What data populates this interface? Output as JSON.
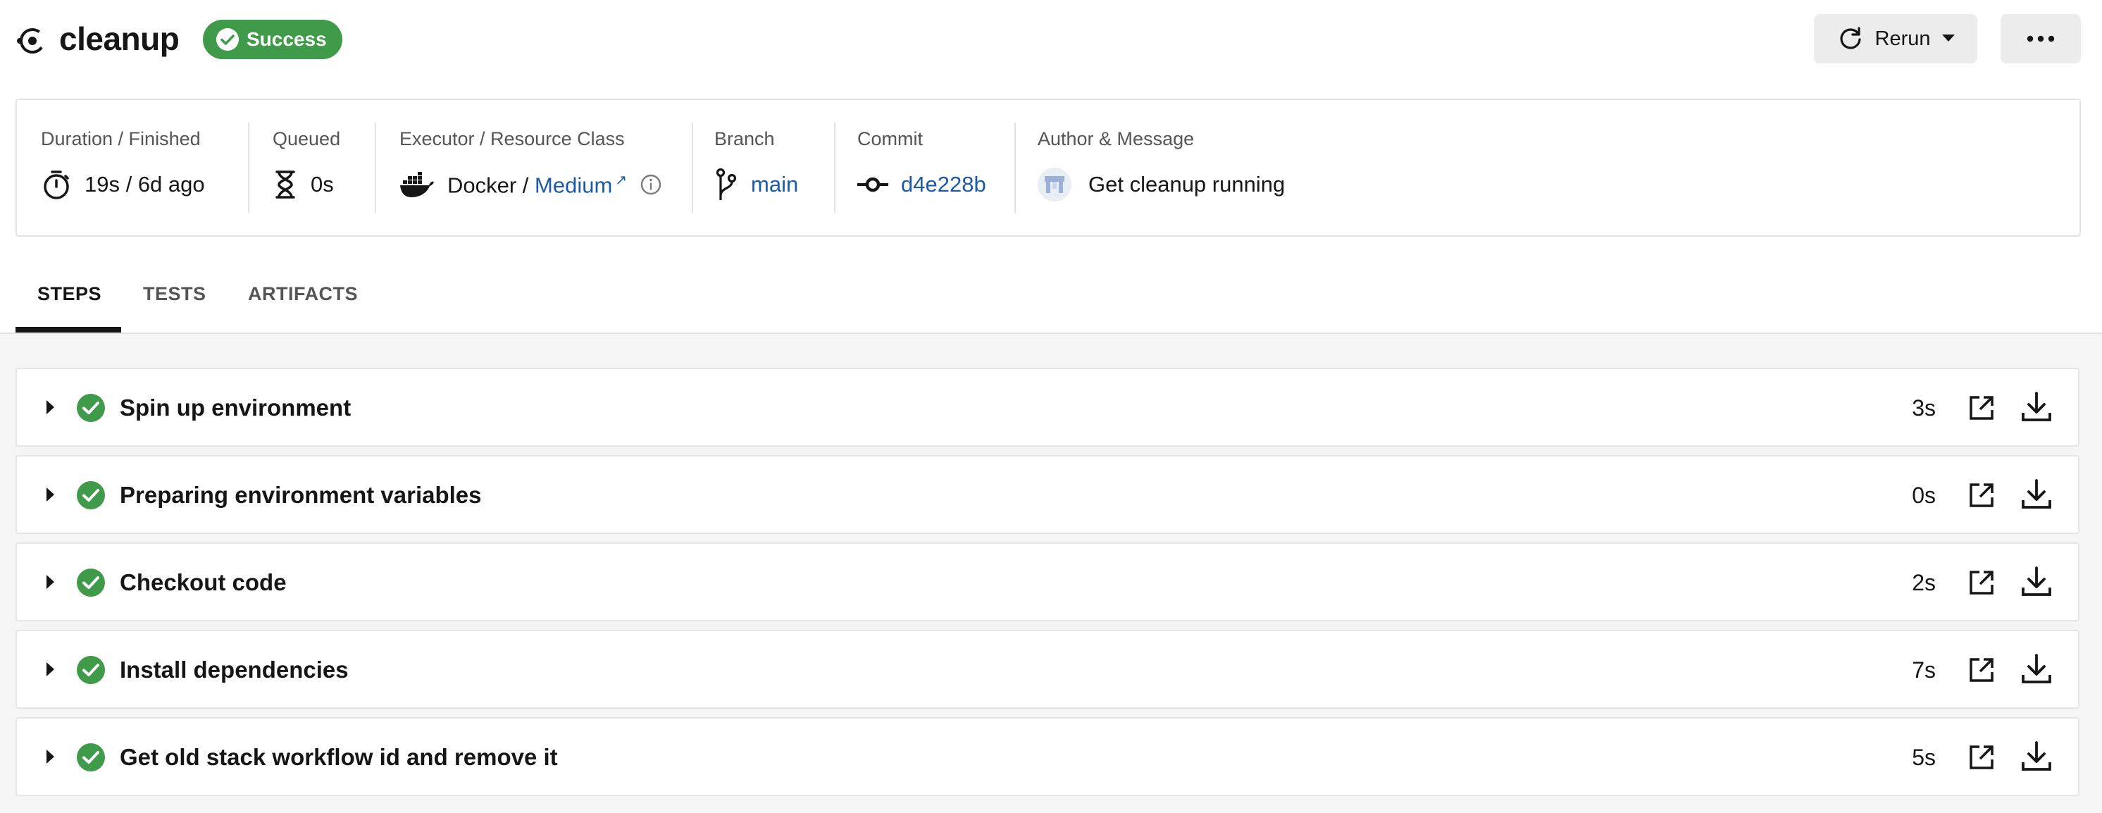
{
  "job": {
    "title": "cleanup",
    "status": "Success",
    "status_color": "#3f9b49"
  },
  "actions": {
    "rerun_label": "Rerun"
  },
  "info": {
    "duration": {
      "label": "Duration / Finished",
      "value": "19s / 6d ago",
      "icon": "stopwatch-icon"
    },
    "queued": {
      "label": "Queued",
      "value": "0s",
      "icon": "hourglass-icon"
    },
    "executor": {
      "label": "Executor / Resource Class",
      "executor": "Docker /",
      "resource_class": "Medium",
      "icon": "docker-icon"
    },
    "branch": {
      "label": "Branch",
      "value": "main",
      "icon": "branch-icon"
    },
    "commit": {
      "label": "Commit",
      "value": "d4e228b",
      "icon": "commit-icon"
    },
    "author": {
      "label": "Author & Message",
      "message": "Get cleanup running"
    }
  },
  "tabs": [
    {
      "label": "STEPS",
      "active": true
    },
    {
      "label": "TESTS",
      "active": false
    },
    {
      "label": "ARTIFACTS",
      "active": false
    }
  ],
  "steps": [
    {
      "name": "Spin up environment",
      "duration": "3s"
    },
    {
      "name": "Preparing environment variables",
      "duration": "0s"
    },
    {
      "name": "Checkout code",
      "duration": "2s"
    },
    {
      "name": "Install dependencies",
      "duration": "7s"
    },
    {
      "name": "Get old stack workflow id and remove it",
      "duration": "5s"
    }
  ],
  "colors": {
    "link": "#1c5aa8",
    "success": "#3f9b49"
  }
}
